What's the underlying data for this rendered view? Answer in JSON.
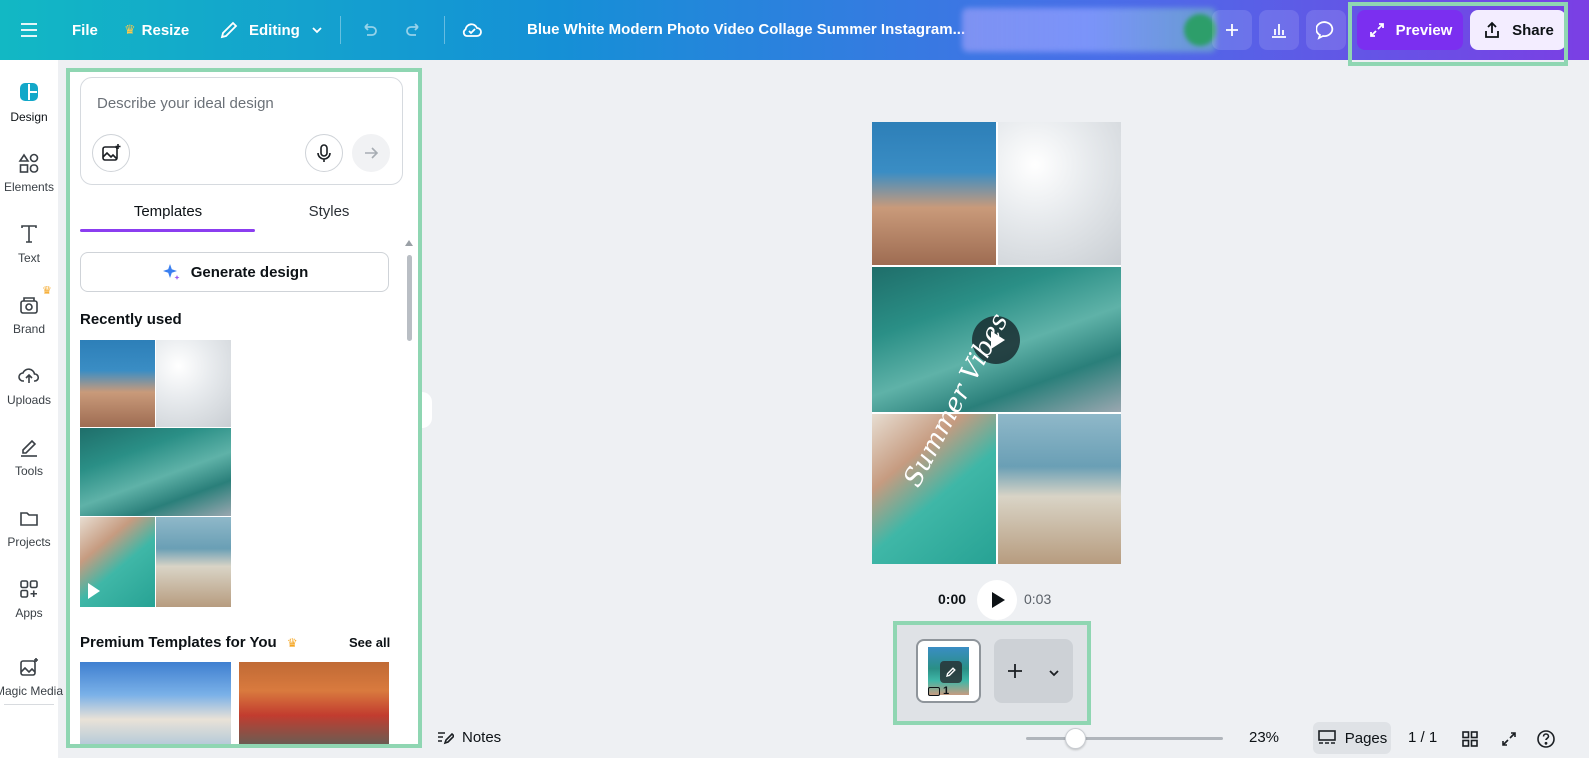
{
  "topbar": {
    "menu_icon": "hamburger-icon",
    "file_label": "File",
    "resize_label": "Resize",
    "editing_label": "Editing",
    "title": "Blue White Modern Photo Video Collage Summer Instagram...",
    "preview_label": "Preview",
    "share_label": "Share"
  },
  "rail": {
    "items": [
      {
        "label": "Design",
        "icon": "design-icon"
      },
      {
        "label": "Elements",
        "icon": "elements-icon"
      },
      {
        "label": "Text",
        "icon": "text-icon"
      },
      {
        "label": "Brand",
        "icon": "brand-icon"
      },
      {
        "label": "Uploads",
        "icon": "upload-cloud-icon"
      },
      {
        "label": "Tools",
        "icon": "tools-icon"
      },
      {
        "label": "Projects",
        "icon": "folder-icon"
      },
      {
        "label": "Apps",
        "icon": "apps-icon"
      },
      {
        "label": "Magic Media",
        "icon": "magic-media-icon"
      }
    ]
  },
  "panel": {
    "prompt_placeholder": "Describe your ideal design",
    "tabs": [
      {
        "label": "Templates",
        "active": true
      },
      {
        "label": "Styles",
        "active": false
      }
    ],
    "generate_label": "Generate design",
    "recently_used_title": "Recently used",
    "premium_title": "Premium Templates for You",
    "see_all_label": "See all"
  },
  "canvas": {
    "script_text": "Summer Vibes"
  },
  "player": {
    "current_time": "0:00",
    "duration": "0:03"
  },
  "pages_strip": {
    "page_number": "1"
  },
  "bottombar": {
    "notes_label": "Notes",
    "zoom": "23%",
    "zoom_fraction": 0.23,
    "pages_label": "Pages",
    "page_count": "1 / 1"
  },
  "colors": {
    "accent_purple": "#7b2ff0",
    "highlight_green": "#8fd6b2",
    "gradient_start": "#12b8c4",
    "gradient_end": "#7b3fe4"
  }
}
